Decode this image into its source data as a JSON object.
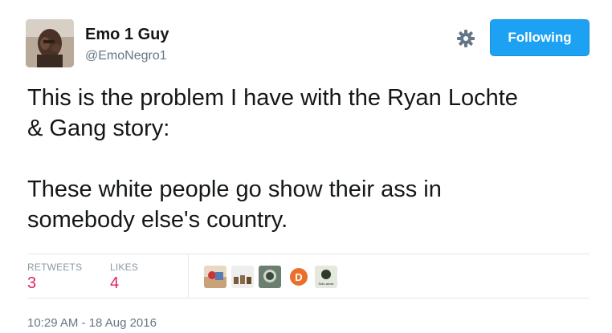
{
  "user": {
    "display_name": "Emo 1 Guy",
    "handle": "@EmoNegro1",
    "avatar_icon": "user-avatar"
  },
  "actions": {
    "settings_icon": "gear-icon",
    "follow_label": "Following",
    "follow_color": "#1da1f2"
  },
  "tweet": {
    "text": "This is the problem I have with the Ryan Lochte\n& Gang story:\n\nThese white people go show their ass in\nsomebody else's country."
  },
  "stats": {
    "retweets_label": "RETWEETS",
    "retweets_count": "3",
    "likes_label": "LIKES",
    "likes_count": "4",
    "count_color": "#e0245e"
  },
  "likers": [
    {
      "icon": "liker-avatar",
      "label": ""
    },
    {
      "icon": "liker-avatar",
      "label": ""
    },
    {
      "icon": "liker-avatar",
      "label": ""
    },
    {
      "icon": "liker-avatar",
      "label": "D"
    },
    {
      "icon": "liker-avatar",
      "label": "Sole-ahole"
    }
  ],
  "timestamp": "10:29 AM - 18 Aug 2016"
}
